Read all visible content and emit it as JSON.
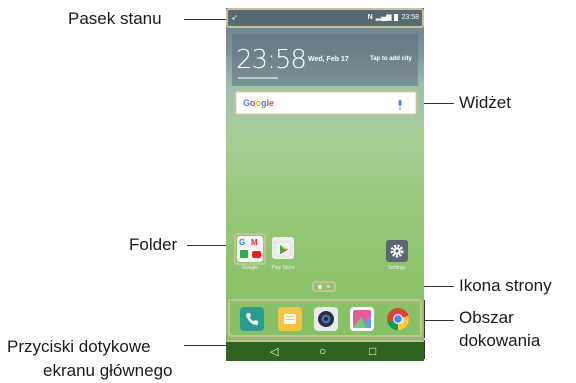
{
  "labels": {
    "status_bar": "Pasek stanu",
    "widget": "Widżet",
    "folder": "Folder",
    "page_icon": "Ikona strony",
    "dock_line1": "Obszar",
    "dock_line2": "dokowania",
    "touch_buttons_line1": "Przyciski dotykowe",
    "touch_buttons_line2": "ekranu głównego"
  },
  "phone": {
    "status_time": "23:58",
    "clock_time": "23:58",
    "clock_date": "Wed, Feb 17",
    "clock_add_city": "Tap to add city",
    "search_logo": "Google",
    "apps": [
      {
        "label": "Google",
        "icon": "folder-icon"
      },
      {
        "label": "Play Store",
        "icon": "play-store-icon"
      },
      {
        "label": "Settings",
        "icon": "gear-icon"
      }
    ],
    "nav": {
      "back": "◁",
      "home": "○",
      "recent": "□"
    }
  },
  "colors": {
    "highlight": "#c8c096",
    "navbar": "#2e6420"
  }
}
